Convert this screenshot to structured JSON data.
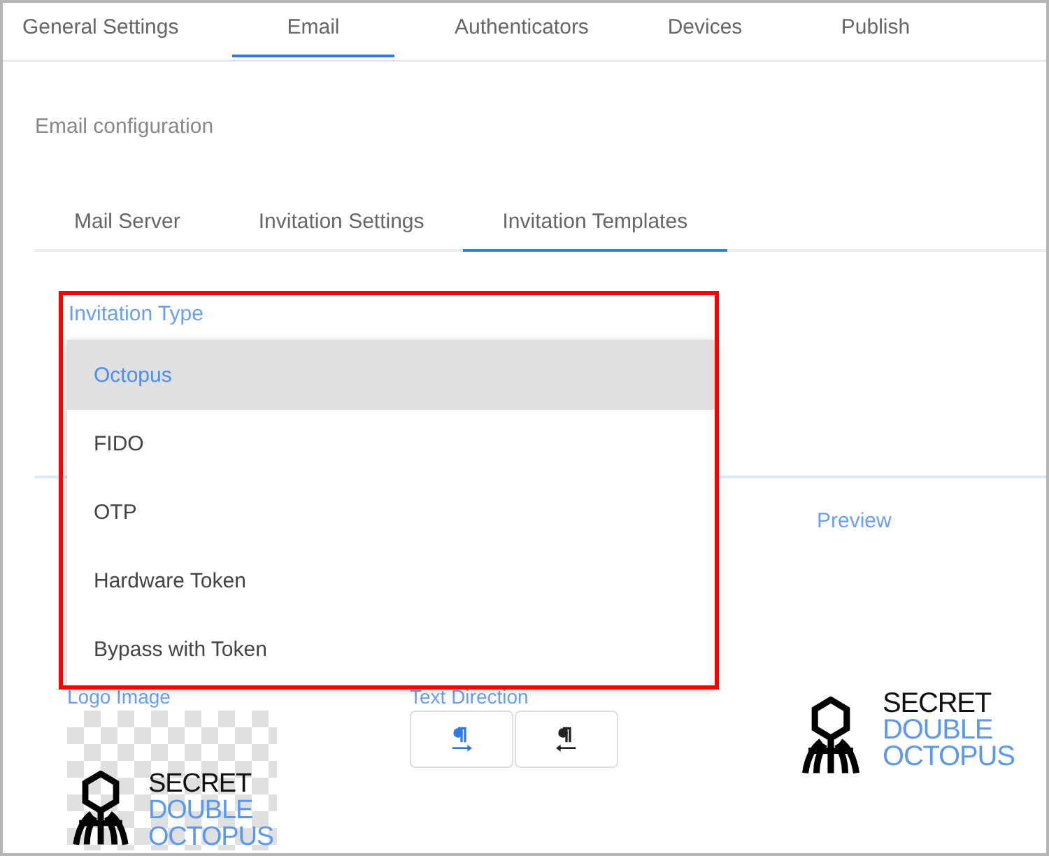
{
  "tabs": [
    {
      "label": "General Settings",
      "selected": false
    },
    {
      "label": "Email",
      "selected": true
    },
    {
      "label": "Authenticators",
      "selected": false
    },
    {
      "label": "Devices",
      "selected": false
    },
    {
      "label": "Publish",
      "selected": false
    }
  ],
  "section_title": "Email configuration",
  "subtabs": [
    {
      "label": "Mail Server",
      "selected": false
    },
    {
      "label": "Invitation Settings",
      "selected": false
    },
    {
      "label": "Invitation Templates",
      "selected": true
    }
  ],
  "invitation_type": {
    "label": "Invitation Type",
    "options": [
      {
        "label": "Octopus",
        "selected": true
      },
      {
        "label": "FIDO",
        "selected": false
      },
      {
        "label": "OTP",
        "selected": false
      },
      {
        "label": "Hardware Token",
        "selected": false
      },
      {
        "label": "Bypass with Token",
        "selected": false
      }
    ]
  },
  "preview": {
    "label": "Preview",
    "logo": [
      "SECRET",
      "DOUBLE",
      "OCTOPUS"
    ]
  },
  "logo_image": {
    "label": "Logo Image",
    "logo": [
      "SECRET",
      "DOUBLE",
      "OCTOPUS"
    ]
  },
  "text_direction": {
    "label": "Text Direction",
    "buttons": [
      {
        "kind": "ltr",
        "selected": true
      },
      {
        "kind": "rtl",
        "selected": false
      }
    ]
  }
}
